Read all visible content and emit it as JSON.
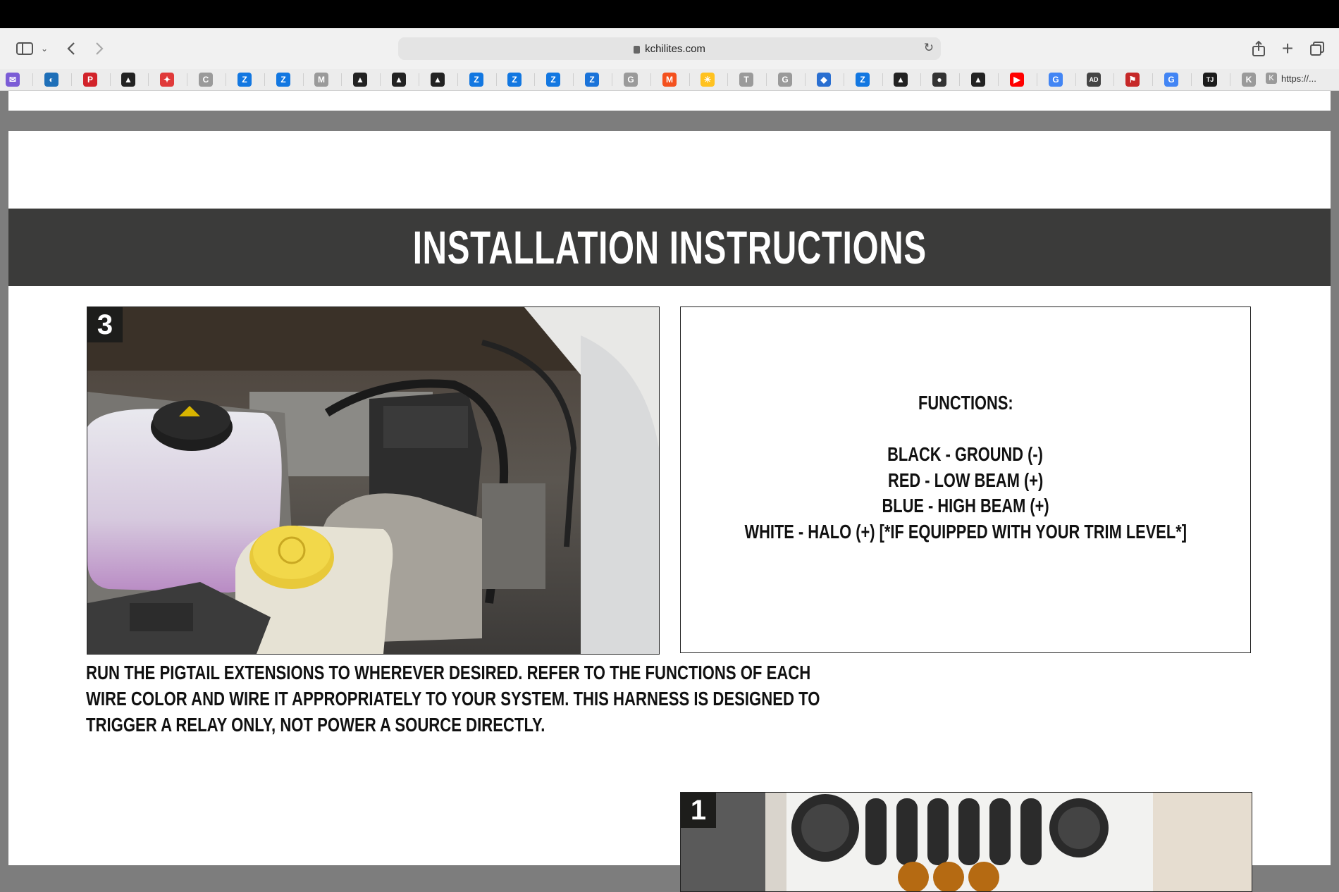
{
  "browser": {
    "url": "kchilites.com",
    "favorites": [
      {
        "icon": "mail-icon",
        "color": "#7b5cd6",
        "glyph": "✉"
      },
      {
        "icon": "edge-icon",
        "color": "#1e6fb8",
        "glyph": "◐"
      },
      {
        "icon": "p-logo-icon",
        "color": "#d2232a",
        "glyph": "P"
      },
      {
        "icon": "kc-logo-icon",
        "color": "#222",
        "glyph": "▲"
      },
      {
        "icon": "red-badge-icon",
        "color": "#e03a3a",
        "glyph": "✦"
      },
      {
        "icon": "letter-c-icon",
        "color": "#9a9a9a",
        "glyph": "C"
      },
      {
        "icon": "zillow-icon",
        "color": "#1277e1",
        "glyph": "Z"
      },
      {
        "icon": "zillow-icon",
        "color": "#1277e1",
        "glyph": "Z"
      },
      {
        "icon": "letter-m-icon",
        "color": "#9a9a9a",
        "glyph": "M"
      },
      {
        "icon": "kc-logo-icon",
        "color": "#222",
        "glyph": "▲"
      },
      {
        "icon": "kc-logo-icon",
        "color": "#222",
        "glyph": "▲"
      },
      {
        "icon": "kc-logo-icon",
        "color": "#222",
        "glyph": "▲"
      },
      {
        "icon": "zillow-icon",
        "color": "#1277e1",
        "glyph": "Z"
      },
      {
        "icon": "zillow-icon",
        "color": "#1277e1",
        "glyph": "Z"
      },
      {
        "icon": "zillow-icon",
        "color": "#1277e1",
        "glyph": "Z"
      },
      {
        "icon": "zillow-blue-icon",
        "color": "#1a73d9",
        "glyph": "Z"
      },
      {
        "icon": "letter-g-icon",
        "color": "#9a9a9a",
        "glyph": "G"
      },
      {
        "icon": "m-red-icon",
        "color": "#f4511e",
        "glyph": "M"
      },
      {
        "icon": "walmart-icon",
        "color": "#ffc220",
        "glyph": "✳"
      },
      {
        "icon": "letter-t-icon",
        "color": "#9a9a9a",
        "glyph": "T"
      },
      {
        "icon": "letter-g-icon",
        "color": "#9a9a9a",
        "glyph": "G"
      },
      {
        "icon": "colorful-logo-icon",
        "color": "#2a6fd1",
        "glyph": "◆"
      },
      {
        "icon": "zillow-icon",
        "color": "#1277e1",
        "glyph": "Z"
      },
      {
        "icon": "kc-logo-icon",
        "color": "#222",
        "glyph": "▲"
      },
      {
        "icon": "dark-circle-icon",
        "color": "#333",
        "glyph": "●"
      },
      {
        "icon": "kc-logo-icon",
        "color": "#222",
        "glyph": "▲"
      },
      {
        "icon": "youtube-icon",
        "color": "#ff0000",
        "glyph": "▶"
      },
      {
        "icon": "google-icon",
        "color": "#4285f4",
        "glyph": "G"
      },
      {
        "icon": "ad-logo-icon",
        "color": "#444",
        "glyph": "AD"
      },
      {
        "icon": "red-flag-icon",
        "color": "#c62828",
        "glyph": "⚑"
      },
      {
        "icon": "google-icon",
        "color": "#4285f4",
        "glyph": "G"
      },
      {
        "icon": "tj-icon",
        "color": "#1b1b1b",
        "glyph": "TJ"
      },
      {
        "icon": "letter-k-icon",
        "color": "#9a9a9a",
        "glyph": "K"
      }
    ],
    "last_favorite": "https://..."
  },
  "page": {
    "banner_title": "INSTALLATION INSTRUCTIONS",
    "step3": {
      "number": "3",
      "description_lines": [
        "RUN THE PIGTAIL EXTENSIONS TO WHEREVER DESIRED. REFER TO THE FUNCTIONS OF EACH",
        "WIRE COLOR AND WIRE IT APPROPRIATELY TO YOUR SYSTEM. THIS HARNESS IS DESIGNED TO",
        "TRIGGER A RELAY ONLY, NOT POWER A SOURCE DIRECTLY."
      ]
    },
    "functions": {
      "heading": "FUNCTIONS:",
      "lines": [
        "BLACK - GROUND (-)",
        "RED - LOW BEAM (+)",
        "BLUE - HIGH BEAM (+)",
        "WHITE - HALO (+) [*IF EQUIPPED WITH YOUR TRIM LEVEL*]"
      ]
    },
    "step1": {
      "number": "1"
    }
  }
}
